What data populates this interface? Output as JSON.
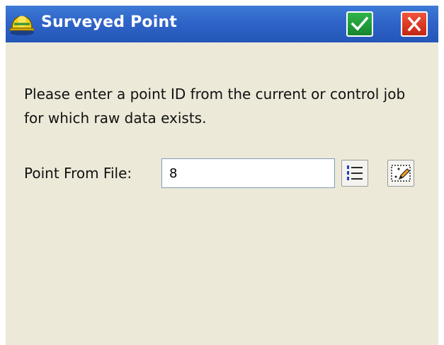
{
  "window": {
    "title": "Surveyed Point",
    "ok_button": "ok",
    "close_button": "close"
  },
  "message": "Please enter a point ID from the current or control job for which raw data exists.",
  "point_field": {
    "label": "Point From File:",
    "value": "8"
  },
  "icons": {
    "title": "hard-hat-survey-icon",
    "ok": "checkmark-icon",
    "close": "x-icon",
    "list": "numbered-list-icon",
    "map": "map-select-icon"
  },
  "colors": {
    "titlebar": "#2f64c8",
    "window_bg": "#ece9d8",
    "ok_button": "#1f9a38",
    "close_button": "#d8361f"
  }
}
